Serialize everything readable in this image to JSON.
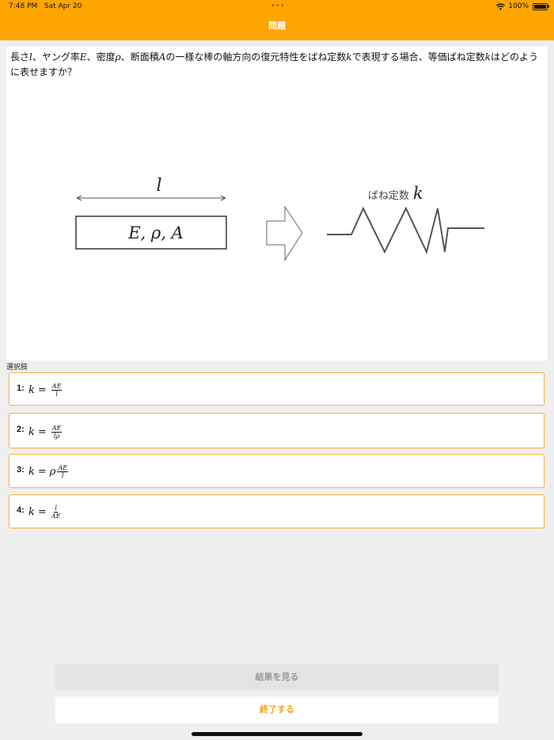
{
  "status_bar": {
    "time": "7:48 PM",
    "date": "Sat Apr 20",
    "battery": "100%",
    "dots": "•••"
  },
  "nav": {
    "title": "問題"
  },
  "question": {
    "segments": [
      "長さ",
      "l",
      "、ヤング率",
      "E",
      "、密度",
      "ρ",
      "、断面積",
      "A",
      "の一様な棒の軸方向の復元特性をばね定数",
      "k",
      "で表現する場合、等価ばね定数",
      "k",
      "はどのように表せますか？"
    ],
    "figure": {
      "length_label": "l",
      "rod_label": "E, ρ, A",
      "spring_label_text": "ばね定数",
      "spring_label_symbol": "k"
    }
  },
  "choices_section_label": "選択肢",
  "choices": [
    {
      "label": "1:",
      "lhs": "k",
      "eq": "=",
      "prefix": "",
      "num": "AE",
      "den": "l"
    },
    {
      "label": "2:",
      "lhs": "k",
      "eq": "=",
      "prefix": "",
      "num": "AE",
      "den": "lρ"
    },
    {
      "label": "3:",
      "lhs": "k",
      "eq": "=",
      "prefix": "ρ",
      "num": "AE",
      "den": "l"
    },
    {
      "label": "4:",
      "lhs": "k",
      "eq": "=",
      "prefix": "",
      "num": "l",
      "den": "AE"
    }
  ],
  "buttons": {
    "result": "結果を見る",
    "end": "終了する"
  },
  "colors": {
    "accent": "#ffa500",
    "choice_border": "#f6b23a",
    "end_text": "#f2a21b"
  },
  "icons": {
    "wifi": "wifi-icon",
    "battery": "battery-icon"
  }
}
